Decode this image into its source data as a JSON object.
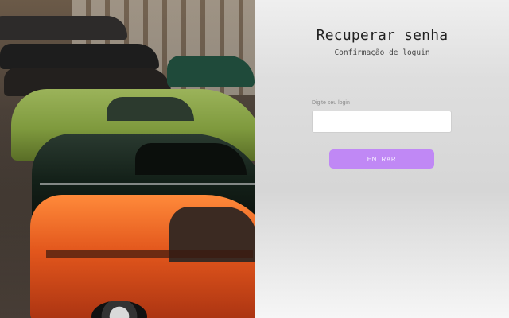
{
  "recovery": {
    "title": "Recuperar senha",
    "subtitle": "Confirmação de loguin",
    "login_label": "Digite seu login",
    "login_value": "",
    "submit_label": "ENTRAR"
  },
  "colors": {
    "accent": "#c088f5",
    "panel_bg": "#e3e3e3",
    "text": "#222222"
  },
  "hero_image": {
    "description_icon": "classic-cars-photo"
  }
}
